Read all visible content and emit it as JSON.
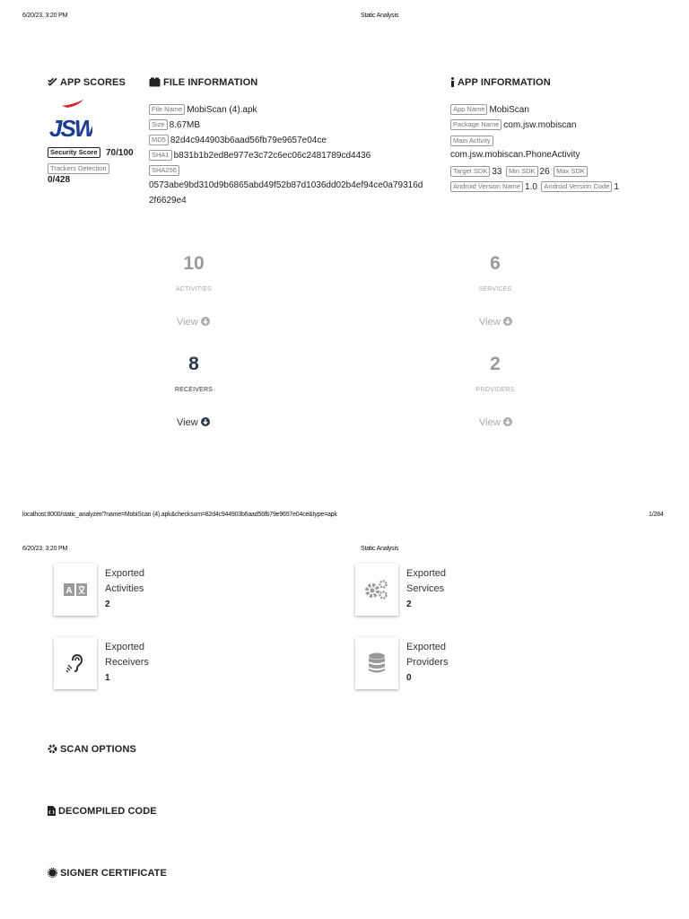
{
  "page1": {
    "print_date": "6/20/23, 3:20 PM",
    "print_title": "Static Analysis",
    "footer_url": "localhost:8000/static_analyzer/?name=MobiScan (4).apk&checksum=82d4c944903b6aad56fb79e9657e04ce&type=apk",
    "footer_page": "1/284"
  },
  "page2": {
    "print_date": "6/20/23, 3:20 PM",
    "print_title": "Static Analysis"
  },
  "app_scores": {
    "title": "APP SCORES",
    "logo_text": "JSW",
    "security_score_label": "Security Score",
    "security_score_value": "70/100",
    "trackers_label": "Trackers Detection",
    "trackers_value": "0/428"
  },
  "file_info": {
    "title": "FILE INFORMATION",
    "file_name_label": "File Name",
    "file_name": "MobiScan (4).apk",
    "size_label": "Size",
    "size": "8.67MB",
    "md5_label": "MD5",
    "md5": "82d4c944903b6aad56fb79e9657e04ce",
    "sha1_label": "SHA1",
    "sha1": "b831b1b2ed8e977e3c72c6ec06c2481789cd4436",
    "sha256_label": "SHA256",
    "sha256_line1": "0573abe9bd310d9b6865abd49f52b87d1036dd02b4ef94ce0a79316d",
    "sha256_line2": "2f6629e4"
  },
  "app_info": {
    "title": "APP INFORMATION",
    "app_name_label": "App Name",
    "app_name": "MobiScan",
    "package_label": "Package Name",
    "package": "com.jsw.mobiscan",
    "main_activity_label": "Main Activity",
    "main_activity": "com.jsw.mobiscan.PhoneActivity",
    "target_sdk_label": "Target SDK",
    "target_sdk": "33",
    "min_sdk_label": "Min SDK",
    "min_sdk": "26",
    "max_sdk_label": "Max SDK",
    "version_name_label": "Android Version Name",
    "version_name": "1.0",
    "version_code_label": "Android Version Code",
    "version_code": "1"
  },
  "stats": [
    {
      "count": "10",
      "label": "ACTIVITIES",
      "view": "View"
    },
    {
      "count": "6",
      "label": "SERVICES",
      "view": "View"
    },
    {
      "count": "8",
      "label": "RECEIVERS",
      "view": "View"
    },
    {
      "count": "2",
      "label": "PROVIDERS",
      "view": "View"
    }
  ],
  "exported": [
    {
      "line1": "Exported",
      "line2": "Activities",
      "count": "2",
      "icon": "translate-icon"
    },
    {
      "line1": "Exported",
      "line2": "Services",
      "count": "2",
      "icon": "cogs-icon"
    },
    {
      "line1": "Exported",
      "line2": "Receivers",
      "count": "1",
      "icon": "assistive-listening-icon"
    },
    {
      "line1": "Exported",
      "line2": "Providers",
      "count": "0",
      "icon": "database-icon"
    }
  ],
  "sections": {
    "scan_options": "SCAN OPTIONS",
    "decompiled_code": "DECOMPILED CODE",
    "signer_certificate": "SIGNER CERTIFICATE"
  }
}
